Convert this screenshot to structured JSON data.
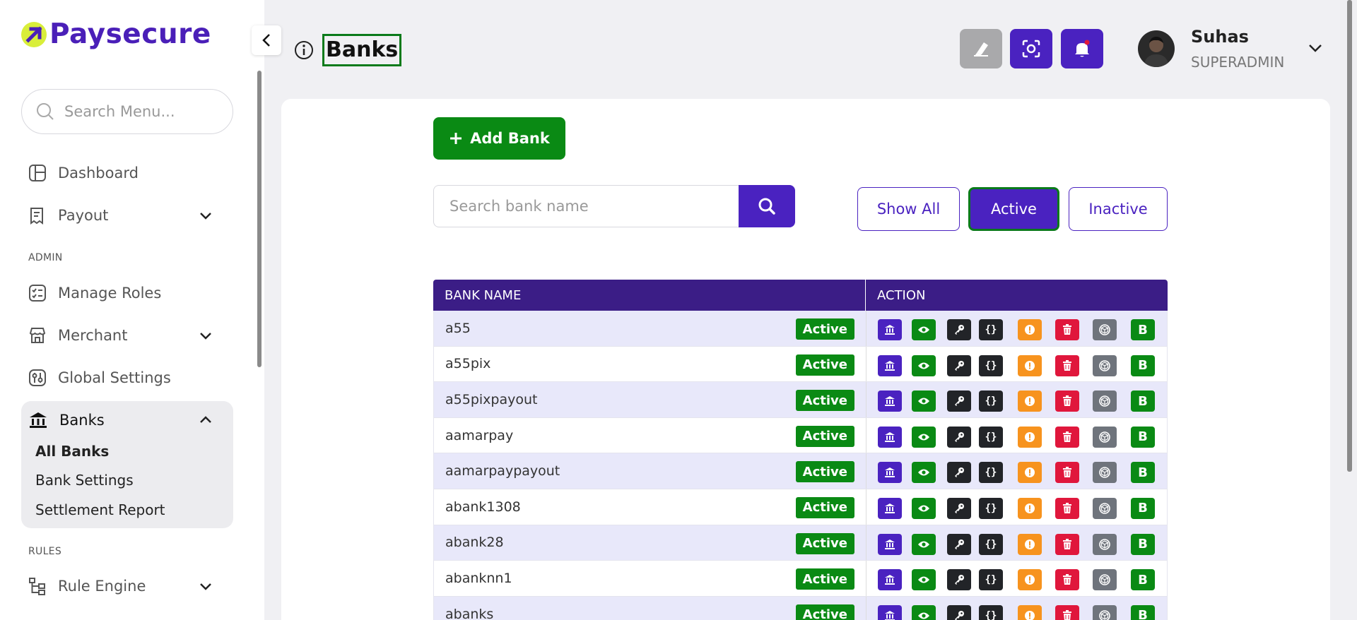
{
  "brand": {
    "name": "Paysecure",
    "accent": "#4a1fb8",
    "mark_color": "#d9ee3a"
  },
  "sidebar": {
    "search_placeholder": "Search Menu...",
    "items": [
      {
        "label": "Dashboard",
        "icon": "dashboard-icon"
      },
      {
        "label": "Payout",
        "icon": "payout-icon"
      },
      {
        "label": "Manage Roles",
        "icon": "roles-icon"
      },
      {
        "label": "Merchant",
        "icon": "merchant-icon"
      },
      {
        "label": "Global Settings",
        "icon": "settings-icon"
      },
      {
        "label": "Banks",
        "icon": "bank-icon"
      },
      {
        "label": "Rule Engine",
        "icon": "rule-engine-icon"
      }
    ],
    "sections": {
      "admin": "ADMIN",
      "rules": "RULES"
    },
    "banks_sub": [
      "All Banks",
      "Bank Settings",
      "Settlement Report"
    ]
  },
  "header": {
    "title": "Banks",
    "user": {
      "name": "Suhas",
      "role": "SUPERADMIN"
    }
  },
  "toolbar": {
    "add_label": "Add Bank",
    "search_placeholder": "Search bank name",
    "filters": [
      "Show All",
      "Active",
      "Inactive"
    ],
    "active_filter": "Active"
  },
  "table": {
    "columns": [
      "BANK NAME",
      "ACTION"
    ],
    "rows": [
      {
        "name": "a55",
        "status": "Active"
      },
      {
        "name": "a55pix",
        "status": "Active"
      },
      {
        "name": "a55pixpayout",
        "status": "Active"
      },
      {
        "name": "aamarpay",
        "status": "Active"
      },
      {
        "name": "aamarpaypayout",
        "status": "Active"
      },
      {
        "name": "abank1308",
        "status": "Active"
      },
      {
        "name": "abank28",
        "status": "Active"
      },
      {
        "name": "abanknn1",
        "status": "Active"
      },
      {
        "name": "abanks",
        "status": "Active"
      }
    ],
    "actions": [
      {
        "name": "bank-icon",
        "color": "#4a22c0",
        "glyph": ""
      },
      {
        "name": "eye-icon",
        "color": "#0a8a14",
        "glyph": ""
      },
      {
        "name": "key-icon",
        "color": "#222428",
        "glyph": ""
      },
      {
        "name": "code-icon",
        "color": "#222428",
        "glyph": "{}"
      },
      {
        "name": "alert-icon",
        "color": "#f7931e",
        "glyph": ""
      },
      {
        "name": "trash-icon",
        "color": "#e0173c",
        "glyph": ""
      },
      {
        "name": "cube-icon",
        "color": "#6f747c",
        "glyph": ""
      },
      {
        "name": "b-badge-icon",
        "color": "#0a8a14",
        "glyph": "B"
      }
    ]
  },
  "colors": {
    "primary": "#4a22c0",
    "success": "#0a8a14",
    "header_bg": "#3b1d86"
  }
}
